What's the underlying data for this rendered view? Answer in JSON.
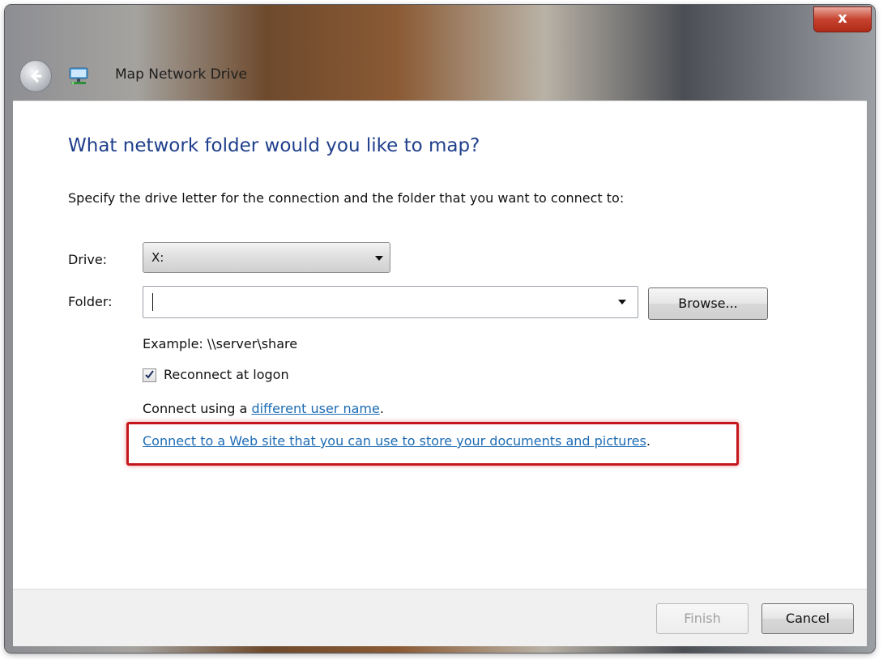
{
  "window": {
    "title": "Map Network Drive",
    "close_label": "x"
  },
  "icons": {
    "back": "back-arrow-icon",
    "app": "network-drive-icon",
    "dropdown": "chevron-down-icon",
    "checkmark": "checkmark-icon"
  },
  "main": {
    "heading": "What network folder would you like to map?",
    "instruction": "Specify the drive letter for the connection and the folder that you want to connect to:",
    "drive_label": "Drive:",
    "drive_value": "X:",
    "folder_label": "Folder:",
    "folder_value": "",
    "browse_label": "Browse...",
    "example": "Example: \\\\server\\share",
    "reconnect_label": "Reconnect at logon",
    "reconnect_checked": true,
    "connect_using_prefix": "Connect using a ",
    "different_user_link": "different user name",
    "connect_using_suffix": ".",
    "web_site_link": "Connect to a Web site that you can use to store your documents and pictures",
    "web_site_suffix": "."
  },
  "footer": {
    "finish_label": "Finish",
    "cancel_label": "Cancel"
  },
  "colors": {
    "heading": "#1f3f8c",
    "link": "#1c6bb5",
    "highlight": "#c4161c",
    "close_button": "#c7422f"
  }
}
